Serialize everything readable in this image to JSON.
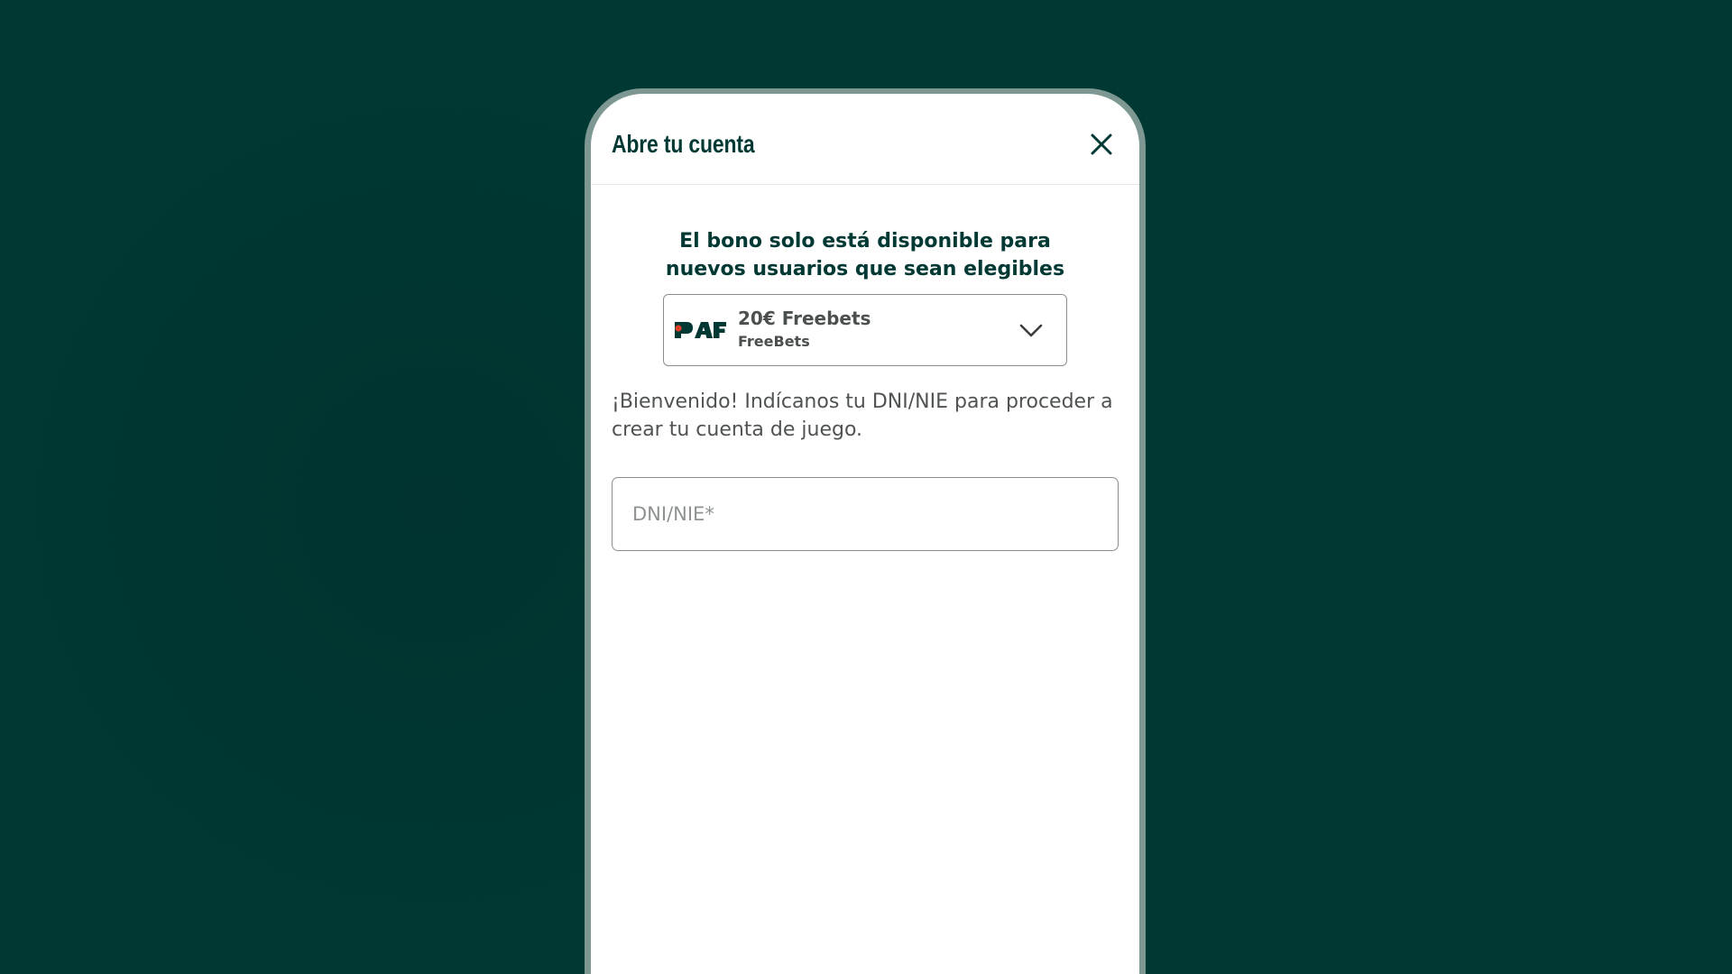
{
  "modal": {
    "title": "Abre tu cuenta",
    "close_icon": "close-icon"
  },
  "bonus": {
    "heading_line1": "El bono solo está disponible para",
    "heading_line2": "nuevos usuarios que sean elegibles",
    "logo_text": "PAF",
    "name": "20€ Freebets",
    "type": "FreeBets",
    "chevron_icon": "chevron-down-icon"
  },
  "welcome": {
    "line1": "¡Bienvenido! Indícanos tu DNI/NIE para proceder a",
    "line2": "crear tu cuenta de juego."
  },
  "dni": {
    "placeholder": "DNI/NIE*",
    "value": ""
  },
  "colors": {
    "background": "#003833",
    "accent_dark_green": "#003833",
    "logo_red": "#e0402a",
    "phone_frame": "#7d9793"
  }
}
